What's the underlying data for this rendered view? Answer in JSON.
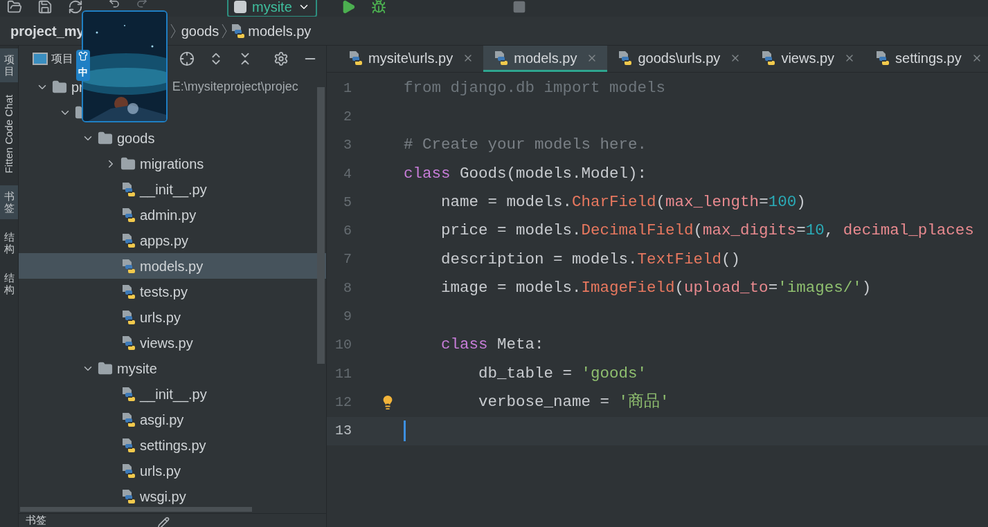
{
  "toolbar": {
    "run_config": "mysite"
  },
  "breadcrumb": [
    {
      "label": "project_my",
      "kind": "project"
    },
    {
      "label": "goods",
      "kind": "folder"
    },
    {
      "label": "models.py",
      "kind": "file"
    }
  ],
  "overlay": {
    "kind": "picture",
    "badge": "中"
  },
  "tool_strip": [
    {
      "label": "项目",
      "kind": "cjk",
      "selected": true
    },
    {
      "label": "Fitten Code Chat",
      "kind": "latin",
      "selected": false
    },
    {
      "label": "书签",
      "kind": "cjk",
      "selected": true
    },
    {
      "label": "结构",
      "kind": "cjk",
      "selected": false
    },
    {
      "label": "结构",
      "kind": "cjk",
      "selected": false
    }
  ],
  "project_panel": {
    "title": "项目",
    "bottom_title": "书签"
  },
  "tree": [
    {
      "label": "pr",
      "path": "E:\\mysiteproject\\projec",
      "kind": "folder",
      "expanded": true,
      "selected": false,
      "children": [
        {
          "kind": "folder",
          "expanded": true,
          "selected": false,
          "children": [
            {
              "label": "goods",
              "kind": "folder",
              "expanded": true,
              "selected": false,
              "children": [
                {
                  "label": "migrations",
                  "kind": "folder",
                  "expanded": false,
                  "selected": false
                },
                {
                  "label": "__init__.py",
                  "kind": "file",
                  "selected": false
                },
                {
                  "label": "admin.py",
                  "kind": "file",
                  "selected": false
                },
                {
                  "label": "apps.py",
                  "kind": "file",
                  "selected": false
                },
                {
                  "label": "models.py",
                  "kind": "file",
                  "selected": true
                },
                {
                  "label": "tests.py",
                  "kind": "file",
                  "selected": false
                },
                {
                  "label": "urls.py",
                  "kind": "file",
                  "selected": false
                },
                {
                  "label": "views.py",
                  "kind": "file",
                  "selected": false
                }
              ]
            },
            {
              "label": "mysite",
              "kind": "folder",
              "expanded": true,
              "selected": false,
              "children": [
                {
                  "label": "__init__.py",
                  "kind": "file",
                  "selected": false
                },
                {
                  "label": "asgi.py",
                  "kind": "file",
                  "selected": false
                },
                {
                  "label": "settings.py",
                  "kind": "file",
                  "selected": false
                },
                {
                  "label": "urls.py",
                  "kind": "file",
                  "selected": false
                },
                {
                  "label": "wsgi.py",
                  "kind": "file",
                  "selected": false
                }
              ]
            }
          ]
        }
      ]
    }
  ],
  "tabs": [
    {
      "label": "mysite\\urls.py",
      "selected": false
    },
    {
      "label": "models.py",
      "selected": true
    },
    {
      "label": "goods\\urls.py",
      "selected": false
    },
    {
      "label": "views.py",
      "selected": false
    },
    {
      "label": "settings.py",
      "selected": false
    }
  ],
  "code": [
    {
      "number": "1",
      "current": false,
      "tokens": [
        {
          "text": "from django.db import models",
          "kind": "dim"
        }
      ]
    },
    {
      "number": "2",
      "current": false
    },
    {
      "number": "3",
      "current": false,
      "tokens": [
        {
          "text": "# Create your models here.",
          "kind": "comment"
        }
      ]
    },
    {
      "number": "4",
      "current": false,
      "tokens": [
        {
          "text": "class",
          "kind": "keyword"
        },
        {
          "text": " Goods(models.Model):",
          "kind": "plain"
        }
      ]
    },
    {
      "number": "5",
      "current": false,
      "tokens": [
        {
          "text": "    name = models.",
          "kind": "plain"
        },
        {
          "text": "CharField",
          "kind": "call"
        },
        {
          "text": "(",
          "kind": "plain"
        },
        {
          "text": "max_length",
          "kind": "param"
        },
        {
          "text": "=",
          "kind": "plain"
        },
        {
          "text": "100",
          "kind": "number"
        },
        {
          "text": ")",
          "kind": "plain"
        }
      ]
    },
    {
      "number": "6",
      "current": false,
      "tokens": [
        {
          "text": "    price = models.",
          "kind": "plain"
        },
        {
          "text": "DecimalField",
          "kind": "call"
        },
        {
          "text": "(",
          "kind": "plain"
        },
        {
          "text": "max_digits",
          "kind": "param"
        },
        {
          "text": "=",
          "kind": "plain"
        },
        {
          "text": "10",
          "kind": "number"
        },
        {
          "text": ", ",
          "kind": "plain"
        },
        {
          "text": "decimal_places",
          "kind": "param"
        }
      ]
    },
    {
      "number": "7",
      "current": false,
      "tokens": [
        {
          "text": "    description = models.",
          "kind": "plain"
        },
        {
          "text": "TextField",
          "kind": "call"
        },
        {
          "text": "()",
          "kind": "plain"
        }
      ]
    },
    {
      "number": "8",
      "current": false,
      "tokens": [
        {
          "text": "    image = models.",
          "kind": "plain"
        },
        {
          "text": "ImageField",
          "kind": "call"
        },
        {
          "text": "(",
          "kind": "plain"
        },
        {
          "text": "upload_to",
          "kind": "param"
        },
        {
          "text": "=",
          "kind": "plain"
        },
        {
          "text": "'images/'",
          "kind": "string"
        },
        {
          "text": ")",
          "kind": "plain"
        }
      ]
    },
    {
      "number": "9",
      "current": false
    },
    {
      "number": "10",
      "current": false,
      "tokens": [
        {
          "text": "    class",
          "kind": "keyword"
        },
        {
          "text": " Meta:",
          "kind": "plain"
        }
      ]
    },
    {
      "number": "11",
      "current": false,
      "tokens": [
        {
          "text": "        db_table = ",
          "kind": "plain"
        },
        {
          "text": "'goods'",
          "kind": "string"
        }
      ]
    },
    {
      "number": "12",
      "current": false,
      "bulb": true,
      "tokens": [
        {
          "text": "        verbose_name = ",
          "kind": "plain"
        },
        {
          "text": "'商品'",
          "kind": "string"
        }
      ]
    },
    {
      "number": "13",
      "current": true
    }
  ]
}
